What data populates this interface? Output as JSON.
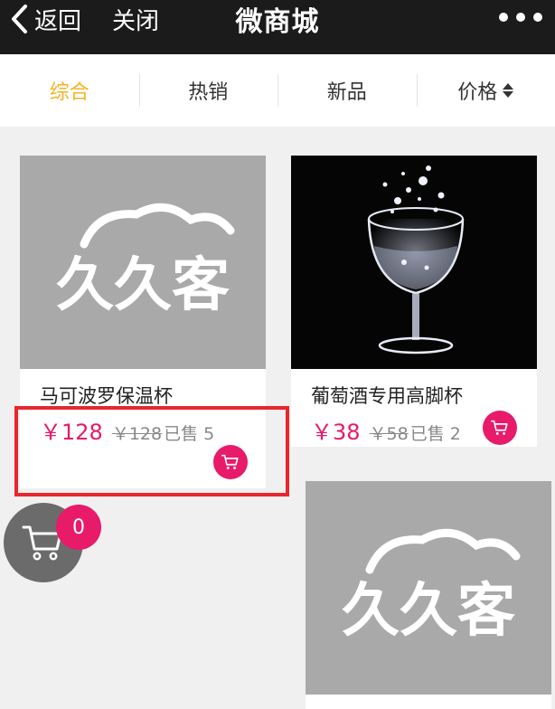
{
  "titlebar": {
    "back_label": "返回",
    "close_label": "关闭",
    "title": "微商城",
    "more_icon": "more-dots-icon"
  },
  "sort_tabs": [
    {
      "label": "综合",
      "active": true
    },
    {
      "label": "热销",
      "active": false
    },
    {
      "label": "新品",
      "active": false
    },
    {
      "label": "价格",
      "active": false,
      "icon": "sort-arrows-icon"
    }
  ],
  "logo": {
    "text": "久久客"
  },
  "products": [
    {
      "name": "马可波罗保温杯",
      "price": "￥128",
      "old_price": "￥128",
      "sold": "已售 5",
      "image": "placeholder-logo"
    },
    {
      "name": "葡萄酒专用高脚杯",
      "price": "￥38",
      "old_price": "￥58",
      "sold": "已售 2",
      "image": "wine-glass"
    },
    {
      "image": "placeholder-logo"
    }
  ],
  "floating_cart": {
    "count": "0",
    "icon": "cart-icon"
  },
  "colors": {
    "accent": "#f5b324",
    "price": "#e81a6a",
    "titlebar": "#1b1b1b",
    "highlight": "#e8262d",
    "placeholder": "#a9a9a9"
  }
}
